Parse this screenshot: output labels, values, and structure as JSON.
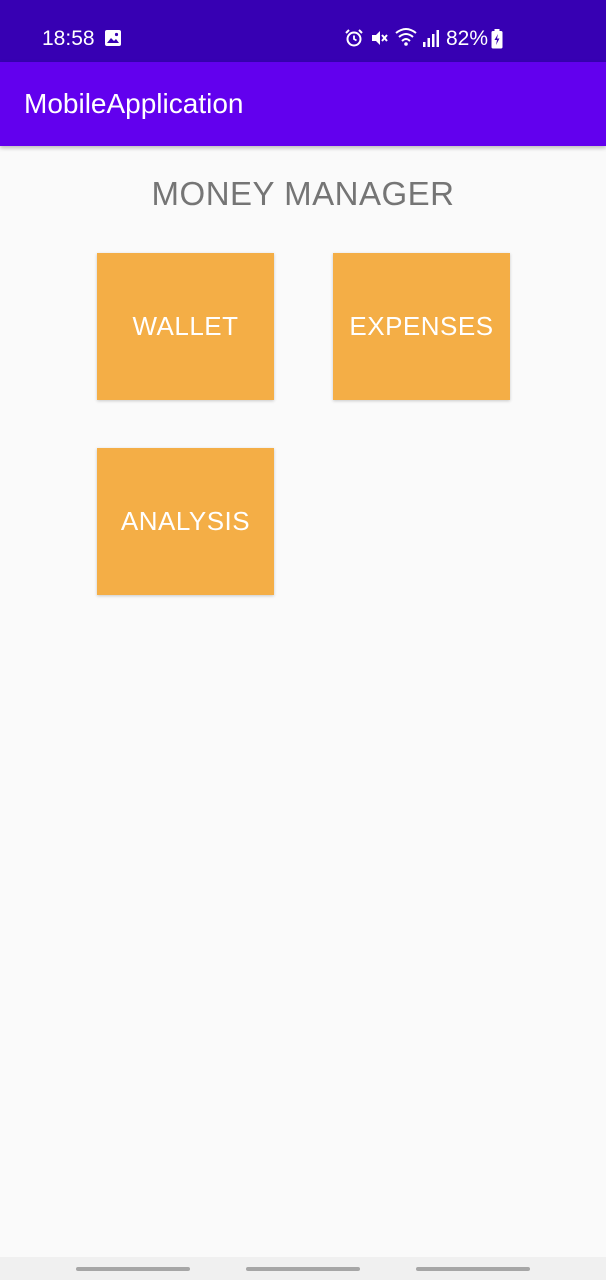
{
  "status_bar": {
    "time": "18:58",
    "battery_percent": "82%",
    "icons": [
      "gallery-icon",
      "alarm-icon",
      "mute-icon",
      "wifi-icon",
      "signal-icon",
      "battery-charging-icon"
    ],
    "background_color": "#3700b3"
  },
  "app_bar": {
    "title": "MobileApplication",
    "background_color": "#6200ee"
  },
  "main": {
    "title": "MONEY MANAGER",
    "tiles": [
      {
        "label": "WALLET"
      },
      {
        "label": "EXPENSES"
      },
      {
        "label": "ANALYSIS"
      }
    ],
    "tile_color": "#f4ae46"
  }
}
